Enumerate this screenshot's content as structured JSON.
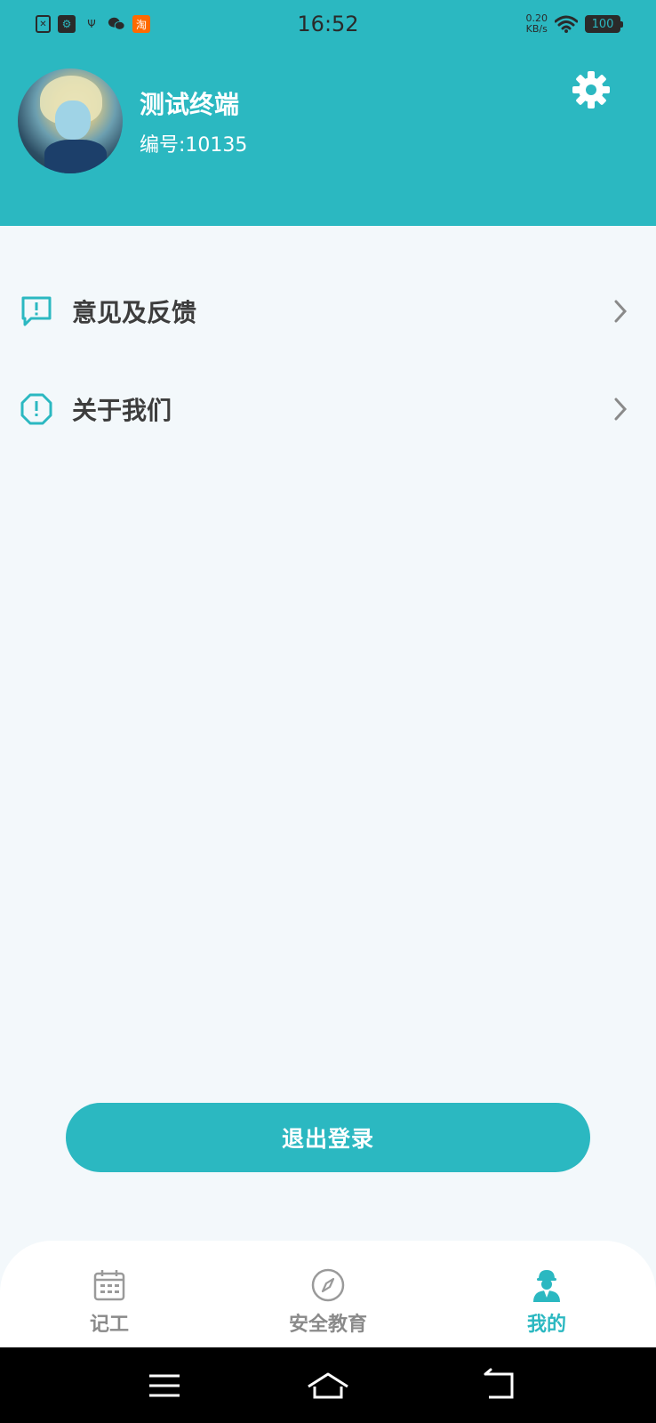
{
  "status_bar": {
    "time": "16:52",
    "net_speed_value": "0.20",
    "net_speed_unit": "KB/s",
    "battery": "100",
    "taobao_glyph": "淘",
    "icons": [
      "sim-icon",
      "usb-debug-icon",
      "usb-icon",
      "wechat-icon",
      "taobao-icon",
      "wifi-icon",
      "battery-icon"
    ]
  },
  "header": {
    "username": "测试终端",
    "user_id": "编号:10135",
    "settings_icon": "gear-icon",
    "background_color": "#2bb8c1"
  },
  "menu": {
    "items": [
      {
        "label": "意见及反馈",
        "icon": "feedback-icon"
      },
      {
        "label": "关于我们",
        "icon": "about-icon"
      }
    ]
  },
  "logout_label": "退出登录",
  "tabs": [
    {
      "label": "记工",
      "icon": "calendar-icon",
      "active": false
    },
    {
      "label": "安全教育",
      "icon": "compass-icon",
      "active": false
    },
    {
      "label": "我的",
      "icon": "worker-icon",
      "active": true
    }
  ],
  "theme": {
    "accent": "#2bb8c1",
    "text": "#3d3d3d",
    "inactive": "#8a8a8a"
  }
}
